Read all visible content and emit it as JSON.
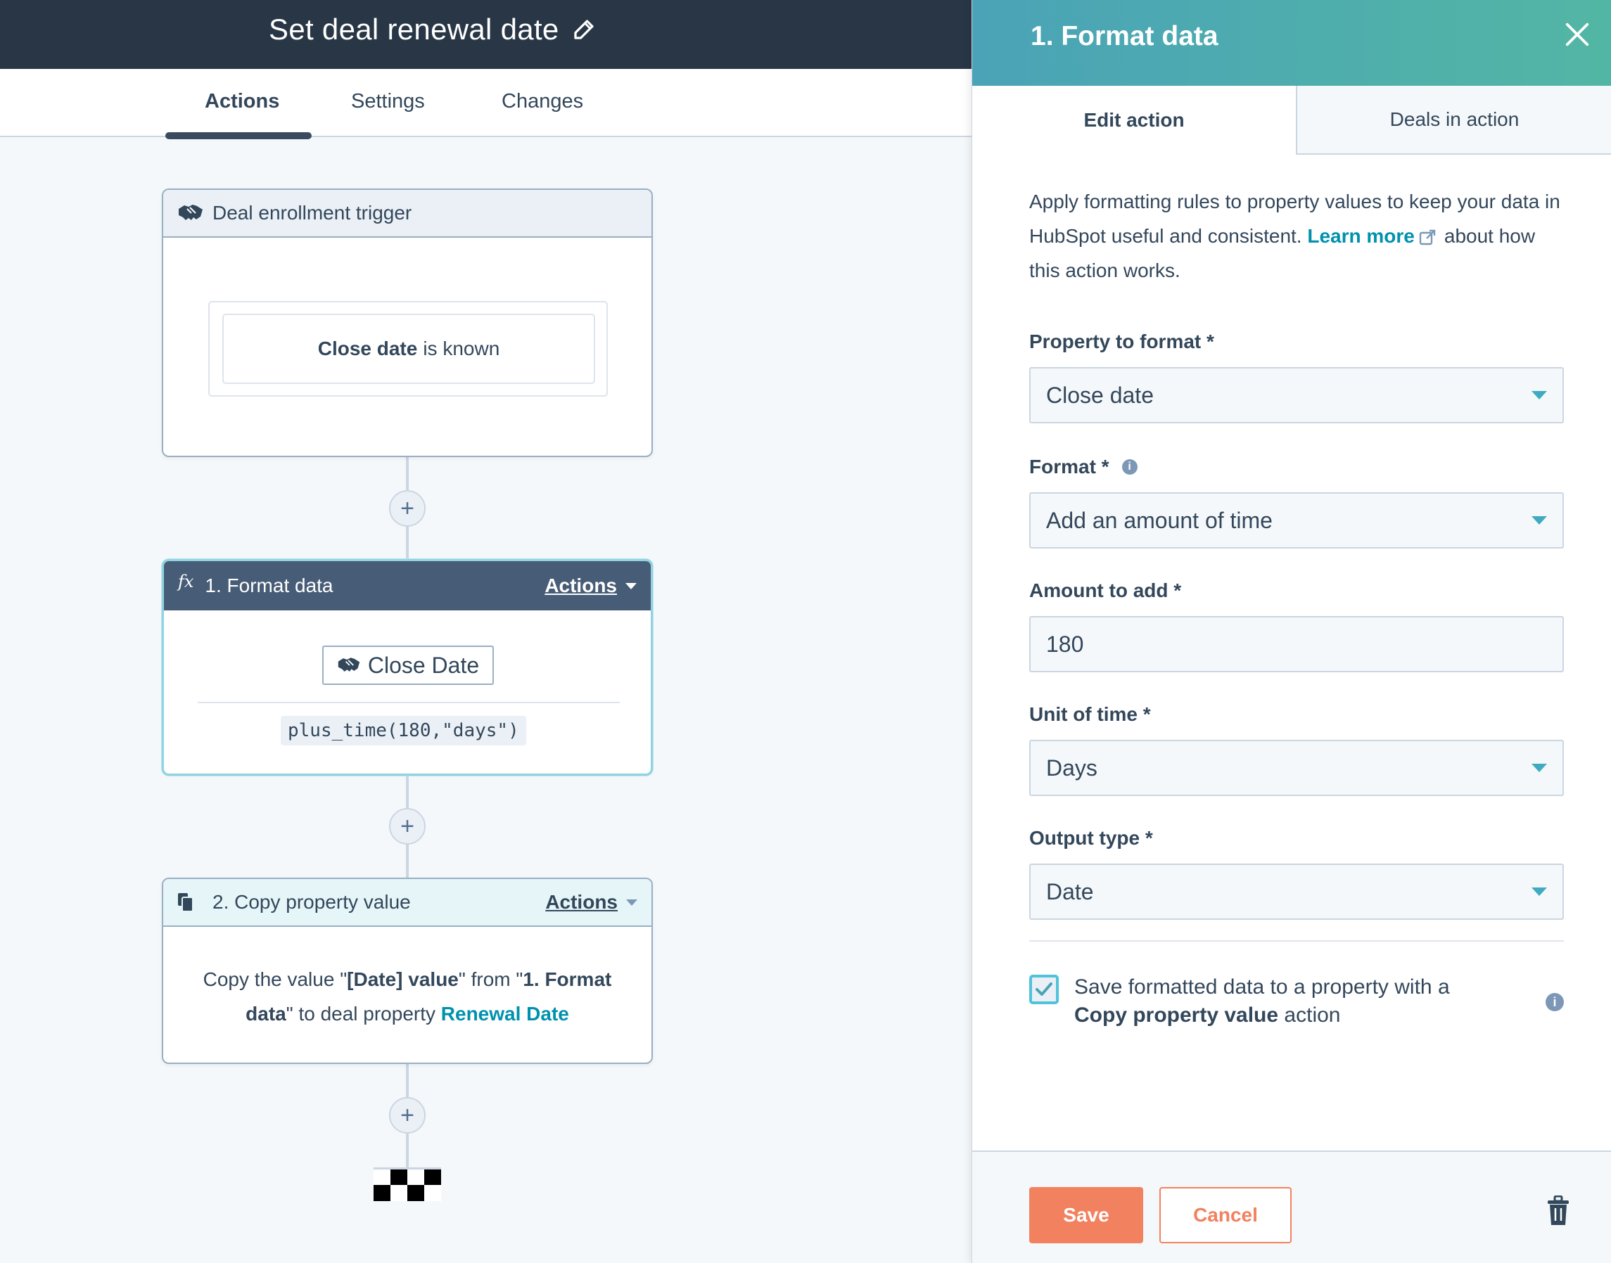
{
  "header": {
    "title": "Set deal renewal date"
  },
  "tabs": [
    {
      "label": "Actions",
      "active": true
    },
    {
      "label": "Settings",
      "active": false
    },
    {
      "label": "Changes",
      "active": false
    }
  ],
  "workflow": {
    "trigger": {
      "title": "Deal enrollment trigger",
      "condition_property": "Close date",
      "condition_rest": "is known"
    },
    "steps": [
      {
        "title": "1. Format data",
        "actions_label": "Actions",
        "chip_label": "Close Date",
        "code": "plus_time(180,\"days\")"
      },
      {
        "title": "2. Copy property value",
        "actions_label": "Actions",
        "desc_part1": "Copy the value \"",
        "desc_bold1": "[Date] value",
        "desc_part2": "\" from \"",
        "desc_bold2": "1. Format data",
        "desc_part3": "\" to deal property ",
        "desc_link": "Renewal Date"
      }
    ],
    "plus_label": "+"
  },
  "panel": {
    "title": "1. Format data",
    "tabs": [
      {
        "label": "Edit action",
        "active": true
      },
      {
        "label": "Deals in action",
        "active": false
      }
    ],
    "intro_part1": "Apply formatting rules to property values to keep your data in HubSpot useful and consistent. ",
    "intro_link": "Learn more",
    "intro_part2": "about how this action works.",
    "fields": [
      {
        "label": "Property to format *",
        "value": "Close date",
        "type": "select"
      },
      {
        "label": "Format *",
        "value": "Add an amount of time",
        "type": "select",
        "has_info": true
      },
      {
        "label": "Amount to add *",
        "value": "180",
        "type": "input"
      },
      {
        "label": "Unit of time *",
        "value": "Days",
        "type": "select"
      },
      {
        "label": "Output type *",
        "value": "Date",
        "type": "select"
      }
    ],
    "checkbox": {
      "checked": true,
      "text_part1": "Save formatted data to a property with a",
      "text_bold": "Copy property value",
      "text_part2": "action"
    },
    "footer": {
      "save_label": "Save",
      "cancel_label": "Cancel"
    }
  },
  "colors": {
    "header_bg": "#283646",
    "accent_teal": "#0091ae",
    "primary_button": "#f2815f",
    "panel_gradient_start": "#4aa3b7",
    "panel_gradient_end": "#52b6a4"
  }
}
